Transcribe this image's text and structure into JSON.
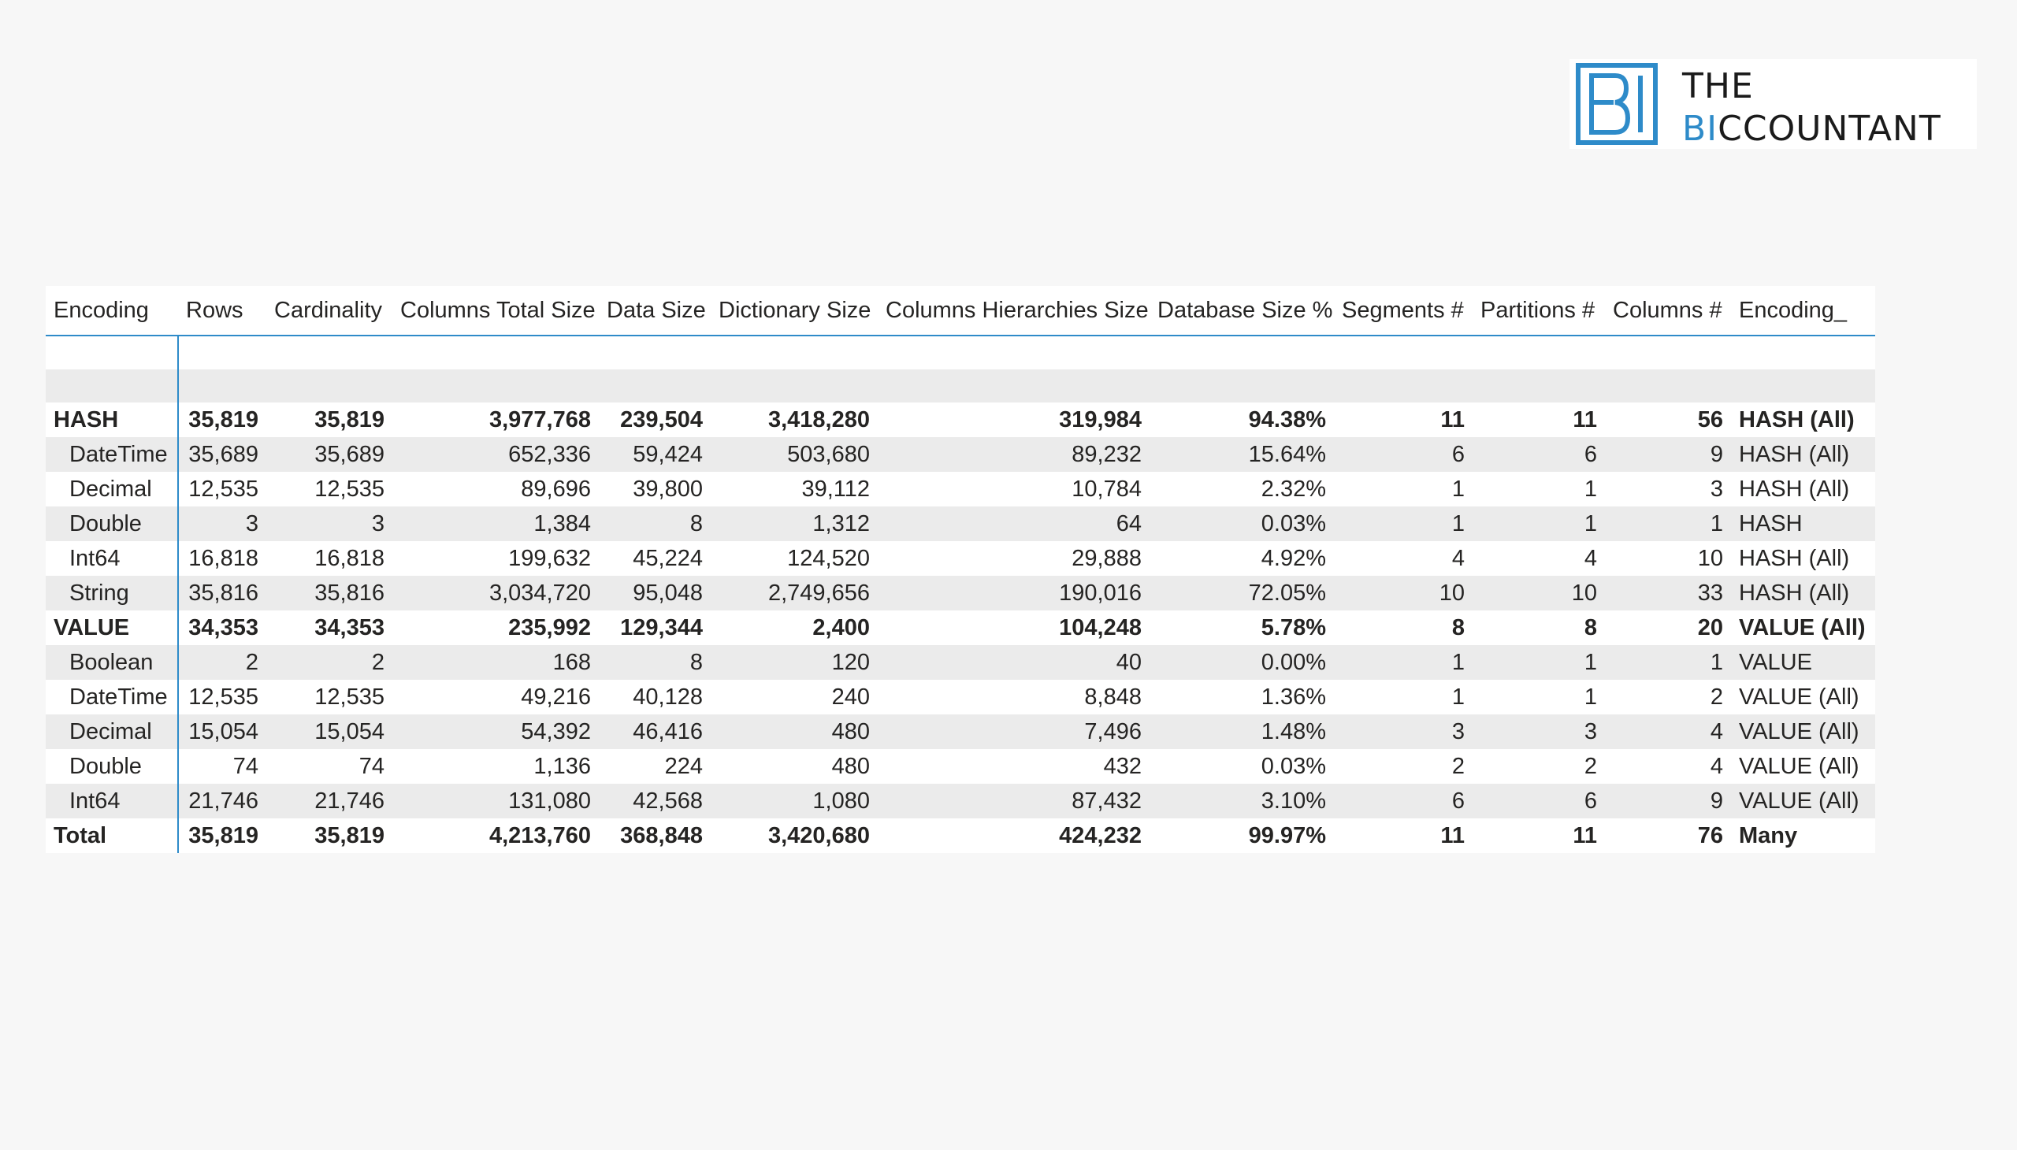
{
  "logo": {
    "line1": "THE",
    "line2_accent": "BI",
    "line2_rest": "CCOUNTANT",
    "brand_color": "#2e8bc9"
  },
  "table": {
    "headers": [
      "Encoding",
      "Rows",
      "Cardinality",
      "Columns Total Size",
      "Data Size",
      "Dictionary Size",
      "Columns Hierarchies Size",
      "Database Size %",
      "Segments #",
      "Partitions #",
      "Columns #",
      "Encoding_"
    ],
    "rows": [
      {
        "label": "HASH",
        "rows": "35,819",
        "cardinality": "35,819",
        "columns_total_size": "3,977,768",
        "data_size": "239,504",
        "dictionary_size": "3,418,280",
        "columns_hierarchies_size": "319,984",
        "database_size_pct": "94.38%",
        "segments": "11",
        "partitions": "11",
        "columns": "56",
        "encoding": "HASH (All)"
      },
      {
        "label": "DateTime",
        "rows": "35,689",
        "cardinality": "35,689",
        "columns_total_size": "652,336",
        "data_size": "59,424",
        "dictionary_size": "503,680",
        "columns_hierarchies_size": "89,232",
        "database_size_pct": "15.64%",
        "segments": "6",
        "partitions": "6",
        "columns": "9",
        "encoding": "HASH (All)"
      },
      {
        "label": "Decimal",
        "rows": "12,535",
        "cardinality": "12,535",
        "columns_total_size": "89,696",
        "data_size": "39,800",
        "dictionary_size": "39,112",
        "columns_hierarchies_size": "10,784",
        "database_size_pct": "2.32%",
        "segments": "1",
        "partitions": "1",
        "columns": "3",
        "encoding": "HASH (All)"
      },
      {
        "label": "Double",
        "rows": "3",
        "cardinality": "3",
        "columns_total_size": "1,384",
        "data_size": "8",
        "dictionary_size": "1,312",
        "columns_hierarchies_size": "64",
        "database_size_pct": "0.03%",
        "segments": "1",
        "partitions": "1",
        "columns": "1",
        "encoding": "HASH"
      },
      {
        "label": "Int64",
        "rows": "16,818",
        "cardinality": "16,818",
        "columns_total_size": "199,632",
        "data_size": "45,224",
        "dictionary_size": "124,520",
        "columns_hierarchies_size": "29,888",
        "database_size_pct": "4.92%",
        "segments": "4",
        "partitions": "4",
        "columns": "10",
        "encoding": "HASH (All)"
      },
      {
        "label": "String",
        "rows": "35,816",
        "cardinality": "35,816",
        "columns_total_size": "3,034,720",
        "data_size": "95,048",
        "dictionary_size": "2,749,656",
        "columns_hierarchies_size": "190,016",
        "database_size_pct": "72.05%",
        "segments": "10",
        "partitions": "10",
        "columns": "33",
        "encoding": "HASH (All)"
      },
      {
        "label": "VALUE",
        "rows": "34,353",
        "cardinality": "34,353",
        "columns_total_size": "235,992",
        "data_size": "129,344",
        "dictionary_size": "2,400",
        "columns_hierarchies_size": "104,248",
        "database_size_pct": "5.78%",
        "segments": "8",
        "partitions": "8",
        "columns": "20",
        "encoding": "VALUE (All)"
      },
      {
        "label": "Boolean",
        "rows": "2",
        "cardinality": "2",
        "columns_total_size": "168",
        "data_size": "8",
        "dictionary_size": "120",
        "columns_hierarchies_size": "40",
        "database_size_pct": "0.00%",
        "segments": "1",
        "partitions": "1",
        "columns": "1",
        "encoding": "VALUE"
      },
      {
        "label": "DateTime",
        "rows": "12,535",
        "cardinality": "12,535",
        "columns_total_size": "49,216",
        "data_size": "40,128",
        "dictionary_size": "240",
        "columns_hierarchies_size": "8,848",
        "database_size_pct": "1.36%",
        "segments": "1",
        "partitions": "1",
        "columns": "2",
        "encoding": "VALUE (All)"
      },
      {
        "label": "Decimal",
        "rows": "15,054",
        "cardinality": "15,054",
        "columns_total_size": "54,392",
        "data_size": "46,416",
        "dictionary_size": "480",
        "columns_hierarchies_size": "7,496",
        "database_size_pct": "1.48%",
        "segments": "3",
        "partitions": "3",
        "columns": "4",
        "encoding": "VALUE (All)"
      },
      {
        "label": "Double",
        "rows": "74",
        "cardinality": "74",
        "columns_total_size": "1,136",
        "data_size": "224",
        "dictionary_size": "480",
        "columns_hierarchies_size": "432",
        "database_size_pct": "0.03%",
        "segments": "2",
        "partitions": "2",
        "columns": "4",
        "encoding": "VALUE (All)"
      },
      {
        "label": "Int64",
        "rows": "21,746",
        "cardinality": "21,746",
        "columns_total_size": "131,080",
        "data_size": "42,568",
        "dictionary_size": "1,080",
        "columns_hierarchies_size": "87,432",
        "database_size_pct": "3.10%",
        "segments": "6",
        "partitions": "6",
        "columns": "9",
        "encoding": "VALUE (All)"
      }
    ],
    "total": {
      "label": "Total",
      "rows": "35,819",
      "cardinality": "35,819",
      "columns_total_size": "4,213,760",
      "data_size": "368,848",
      "dictionary_size": "3,420,680",
      "columns_hierarchies_size": "424,232",
      "database_size_pct": "99.97%",
      "segments": "11",
      "partitions": "11",
      "columns": "76",
      "encoding": "Many"
    }
  }
}
